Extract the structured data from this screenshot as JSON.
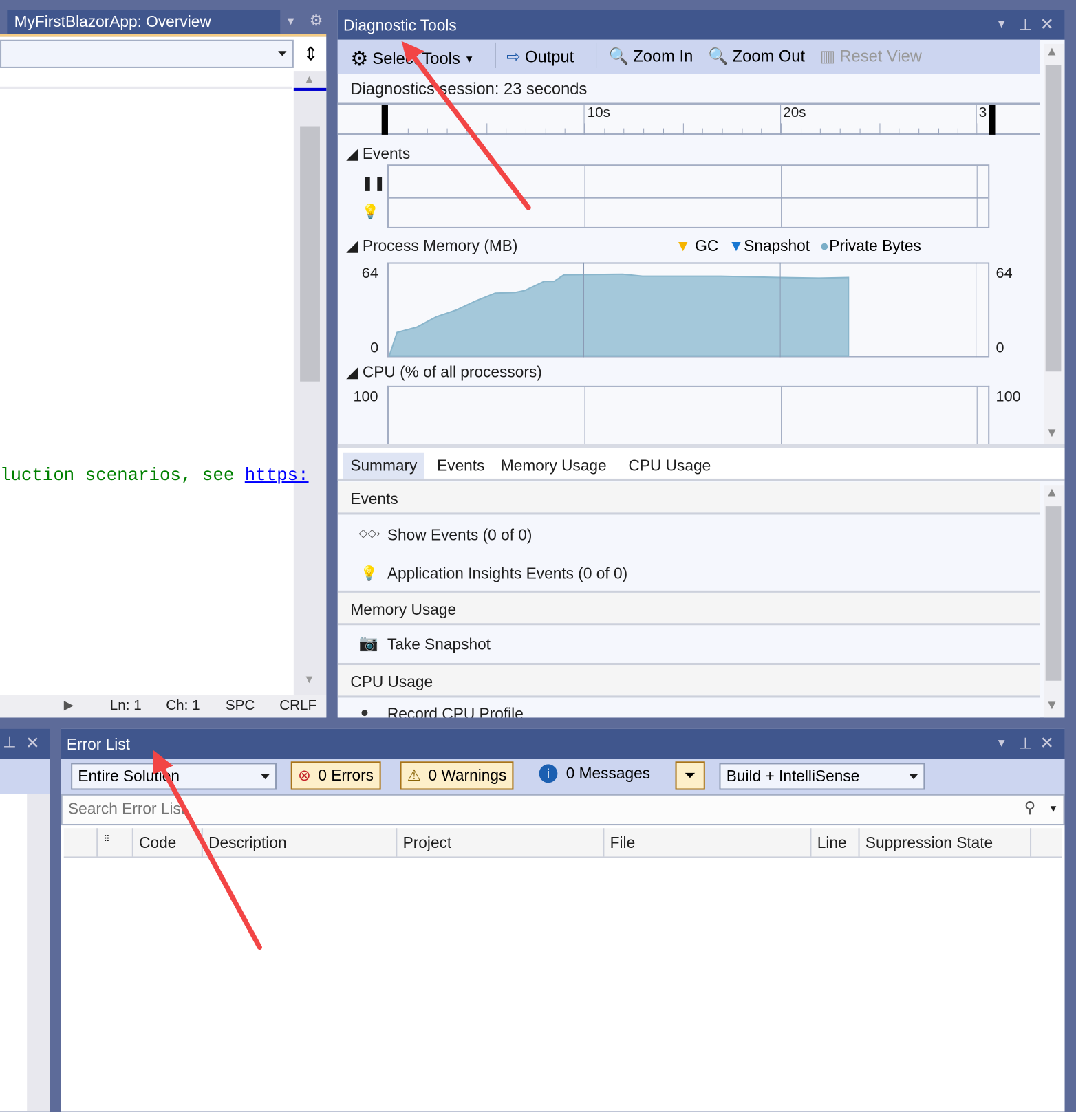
{
  "left_panel": {
    "title": "MyFirstBlazorApp: Overview",
    "code_text": "luction scenarios, see ",
    "code_link": "https:",
    "status": {
      "ln": "Ln: 1",
      "ch": "Ch: 1",
      "spc": "SPC",
      "crlf": "CRLF"
    }
  },
  "diag": {
    "title": "Diagnostic Tools",
    "toolbar": {
      "select_tools": "Select Tools",
      "output": "Output",
      "zoom_in": "Zoom In",
      "zoom_out": "Zoom Out",
      "reset_view": "Reset View"
    },
    "session": "Diagnostics session: 23 seconds",
    "ruler": {
      "t10": "10s",
      "t20": "20s",
      "t30": "3"
    },
    "events_label": "Events",
    "memory_label": "Process Memory (MB)",
    "legend": {
      "gc": "GC",
      "snapshot": "Snapshot",
      "private_bytes": "Private Bytes"
    },
    "cpu_label": "CPU (% of all processors)",
    "tabs": [
      "Summary",
      "Events",
      "Memory Usage",
      "CPU Usage"
    ],
    "summary": {
      "events_header": "Events",
      "show_events": "Show Events (0 of 0)",
      "ai_events": "Application Insights Events (0 of 0)",
      "memory_header": "Memory Usage",
      "take_snapshot": "Take Snapshot",
      "cpu_header": "CPU Usage",
      "record_cpu": "Record CPU Profile"
    }
  },
  "error_list": {
    "title": "Error List",
    "scope": "Entire Solution",
    "errors": "0 Errors",
    "warnings": "0 Warnings",
    "messages": "0 Messages",
    "build_filter": "Build + IntelliSense",
    "search_placeholder": "Search Error List",
    "columns": [
      "Code",
      "Description",
      "Project",
      "File",
      "Line",
      "Suppression State"
    ]
  },
  "colors": {
    "header": "#40568d",
    "toolbar": "#ccd5f0",
    "memory_fill": "#a4c8da",
    "accent_arrow": "#f24545"
  },
  "chart_data": [
    {
      "type": "area",
      "title": "Process Memory (MB)",
      "series": [
        {
          "name": "Private Bytes",
          "x": [
            0.1,
            0.5,
            1.5,
            2.5,
            3.5,
            4.5,
            5.5,
            6.5,
            7,
            8,
            8.5,
            9,
            12,
            13,
            17,
            20,
            22,
            23.5
          ],
          "values": [
            0,
            18,
            22,
            30,
            35,
            42,
            48,
            48.5,
            50,
            57,
            57,
            62,
            62.5,
            61,
            61,
            60,
            59.5,
            60
          ]
        }
      ],
      "xlabel": "seconds",
      "xlim": [
        0,
        30
      ],
      "ylim": [
        0,
        64
      ],
      "yticks": [
        "64",
        "0"
      ]
    },
    {
      "type": "line",
      "title": "CPU (% of all processors)",
      "series": [],
      "ylim": [
        0,
        100
      ],
      "yticks": [
        "100"
      ]
    }
  ]
}
